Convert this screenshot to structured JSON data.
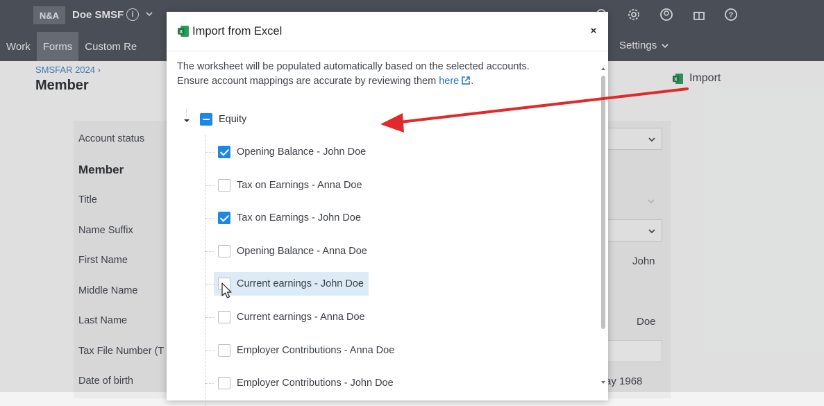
{
  "app": {
    "badge": "N&A",
    "fund_name": "Doe SMSF"
  },
  "nav": {
    "items": [
      "Work",
      "Forms",
      "Custom Re"
    ],
    "active": "Forms",
    "right_item": "Settings"
  },
  "page": {
    "breadcrumb": "SMSFAR 2024",
    "title": "Member",
    "import_label": "Import"
  },
  "form": {
    "account_status_label": "Account status",
    "member_section": "Member",
    "title_label": "Title",
    "name_suffix_label": "Name Suffix",
    "first_name_label": "First Name",
    "first_name_value": "John",
    "middle_name_label": "Middle Name",
    "last_name_label": "Last Name",
    "last_name_value": "Doe",
    "tfn_label": "Tax File Number (T",
    "dob_label": "Date of birth",
    "dob_value": "ay 1968"
  },
  "modal": {
    "title": "Import from Excel",
    "close": "×",
    "desc_line1": "The worksheet will be populated automatically based on the selected accounts.",
    "desc_line2": "Ensure account mappings are accurate by reviewing them",
    "desc_link": "here",
    "desc_end": ".",
    "tree": {
      "root_label": "Equity",
      "items": [
        {
          "label": "Opening Balance - John Doe",
          "checked": true
        },
        {
          "label": "Tax on Earnings - Anna Doe",
          "checked": false
        },
        {
          "label": "Tax on Earnings - John Doe",
          "checked": true
        },
        {
          "label": "Opening Balance - Anna Doe",
          "checked": false
        },
        {
          "label": "Current earnings - John Doe",
          "checked": false,
          "hover": true
        },
        {
          "label": "Current earnings - Anna Doe",
          "checked": false
        },
        {
          "label": "Employer Contributions - Anna Doe",
          "checked": false
        },
        {
          "label": "Employer Contributions - John Doe",
          "checked": false
        }
      ]
    }
  },
  "colors": {
    "accent": "#1e87e5",
    "arrow": "#e0292b",
    "topbar": "#4e535b",
    "excel_green": "#1d7a45"
  }
}
